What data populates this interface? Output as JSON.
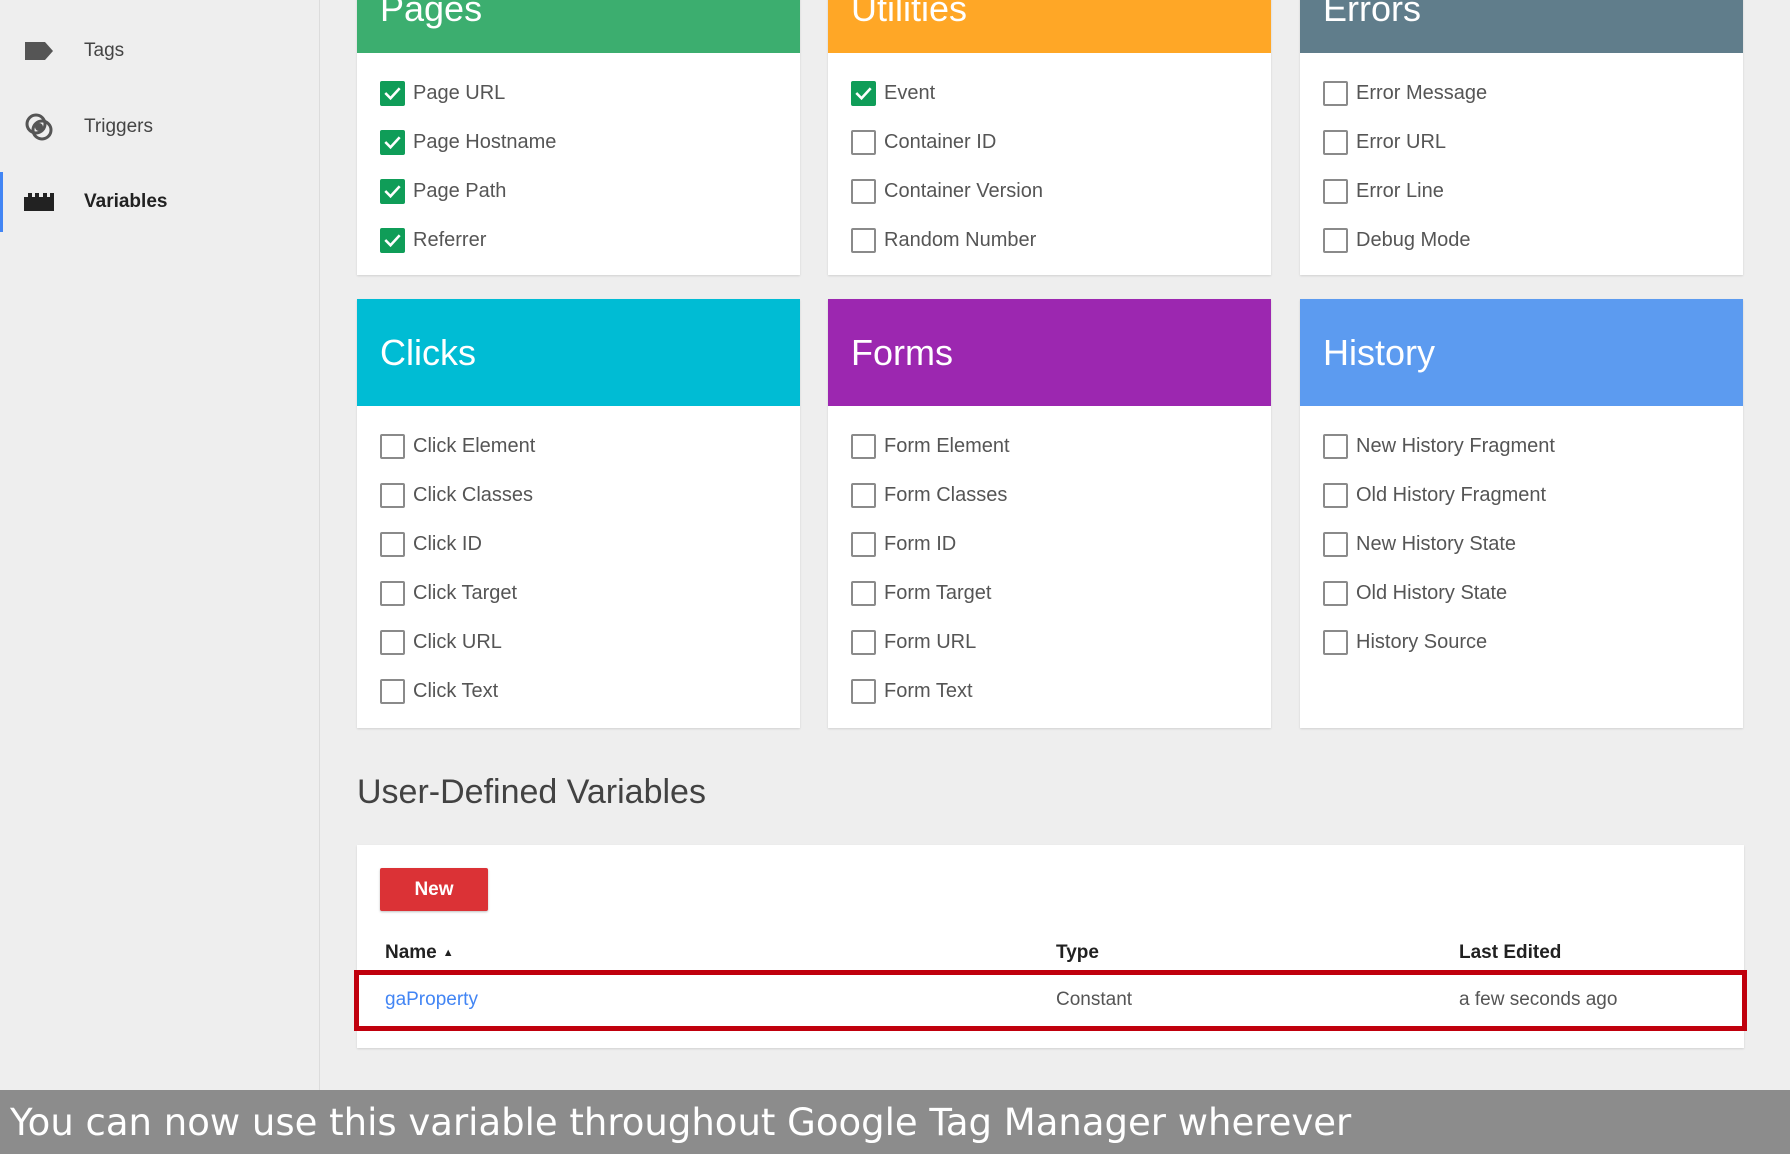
{
  "sidebar": {
    "items": [
      {
        "label": "Tags",
        "icon": "tag-icon"
      },
      {
        "label": "Triggers",
        "icon": "trigger-icon"
      },
      {
        "label": "Variables",
        "icon": "variables-icon",
        "active": true
      }
    ]
  },
  "builtin": {
    "pages": {
      "title": "Pages",
      "color": "#3cae6f",
      "items": [
        {
          "label": "Page URL",
          "checked": true
        },
        {
          "label": "Page Hostname",
          "checked": true
        },
        {
          "label": "Page Path",
          "checked": true
        },
        {
          "label": "Referrer",
          "checked": true
        }
      ]
    },
    "utilities": {
      "title": "Utilities",
      "color": "#ffa726",
      "items": [
        {
          "label": "Event",
          "checked": true
        },
        {
          "label": "Container ID",
          "checked": false
        },
        {
          "label": "Container Version",
          "checked": false
        },
        {
          "label": "Random Number",
          "checked": false
        }
      ]
    },
    "errors": {
      "title": "Errors",
      "color": "#607d8b",
      "items": [
        {
          "label": "Error Message",
          "checked": false
        },
        {
          "label": "Error URL",
          "checked": false
        },
        {
          "label": "Error Line",
          "checked": false
        },
        {
          "label": "Debug Mode",
          "checked": false
        }
      ]
    },
    "clicks": {
      "title": "Clicks",
      "color": "#00bcd4",
      "items": [
        {
          "label": "Click Element",
          "checked": false
        },
        {
          "label": "Click Classes",
          "checked": false
        },
        {
          "label": "Click ID",
          "checked": false
        },
        {
          "label": "Click Target",
          "checked": false
        },
        {
          "label": "Click URL",
          "checked": false
        },
        {
          "label": "Click Text",
          "checked": false
        }
      ]
    },
    "forms": {
      "title": "Forms",
      "color": "#9c27b0",
      "items": [
        {
          "label": "Form Element",
          "checked": false
        },
        {
          "label": "Form Classes",
          "checked": false
        },
        {
          "label": "Form ID",
          "checked": false
        },
        {
          "label": "Form Target",
          "checked": false
        },
        {
          "label": "Form URL",
          "checked": false
        },
        {
          "label": "Form Text",
          "checked": false
        }
      ]
    },
    "history": {
      "title": "History",
      "color": "#5c9bf0",
      "items": [
        {
          "label": "New History Fragment",
          "checked": false
        },
        {
          "label": "Old History Fragment",
          "checked": false
        },
        {
          "label": "New History State",
          "checked": false
        },
        {
          "label": "Old History State",
          "checked": false
        },
        {
          "label": "History Source",
          "checked": false
        }
      ]
    }
  },
  "user_defined": {
    "title": "User-Defined Variables",
    "new_label": "New",
    "columns": {
      "name": "Name",
      "type": "Type",
      "last_edited": "Last Edited"
    },
    "sort_indicator": "▲",
    "rows": [
      {
        "name": "gaProperty",
        "type": "Constant",
        "last_edited": "a few seconds ago"
      }
    ]
  },
  "caption": "You can now use this variable throughout Google Tag Manager wherever",
  "colors": {
    "check": "#0f9d58",
    "new_button": "#db3236",
    "highlight": "#c0000d",
    "link": "#4285f4"
  }
}
